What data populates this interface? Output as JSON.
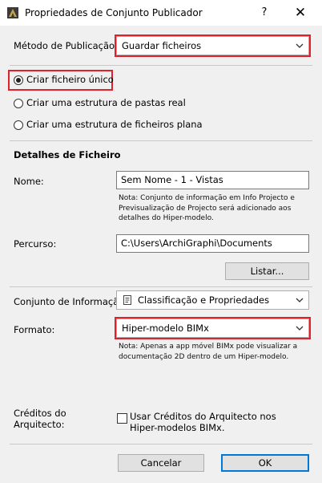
{
  "window": {
    "title": "Propriedades de Conjunto Publicador",
    "help_glyph": "?",
    "close_glyph": "✕"
  },
  "publish_method": {
    "label": "Método de Publicação:",
    "value": "Guardar ficheiros"
  },
  "structure_options": [
    {
      "label": "Criar ficheiro único",
      "selected": true
    },
    {
      "label": "Criar uma estrutura de pastas real",
      "selected": false
    },
    {
      "label": "Criar uma estrutura de ficheiros plana",
      "selected": false
    }
  ],
  "file_details": {
    "heading": "Detalhes de Ficheiro",
    "name_label": "Nome:",
    "name_value": "Sem Nome - 1 - Vistas",
    "name_note": "Nota: Conjunto de informação em Info Projecto e Previsualização de Projecto será adicionado aos detalhes do Hiper-modelo.",
    "path_label": "Percurso:",
    "path_value": "C:\\Users\\ArchiGraphi\\Documents",
    "browse_label": "Listar...",
    "info_set_label": "Conjunto de Informaçã",
    "info_set_value": "Classificação e Propriedades",
    "format_label": "Formato:",
    "format_value": "Hiper-modelo BIMx",
    "format_note": "Nota: Apenas a app móvel BIMx pode visualizar a documentação 2D dentro de um Hiper-modelo.",
    "credits_label": "Créditos do Arquitecto:",
    "credits_checkbox_label": "Usar Créditos do Arquitecto nos Hiper-modelos BIMx.",
    "credits_checked": false
  },
  "footer": {
    "cancel_label": "Cancelar",
    "ok_label": "OK"
  },
  "colors": {
    "highlight": "#e0212b",
    "default_button_border": "#0078d7"
  }
}
